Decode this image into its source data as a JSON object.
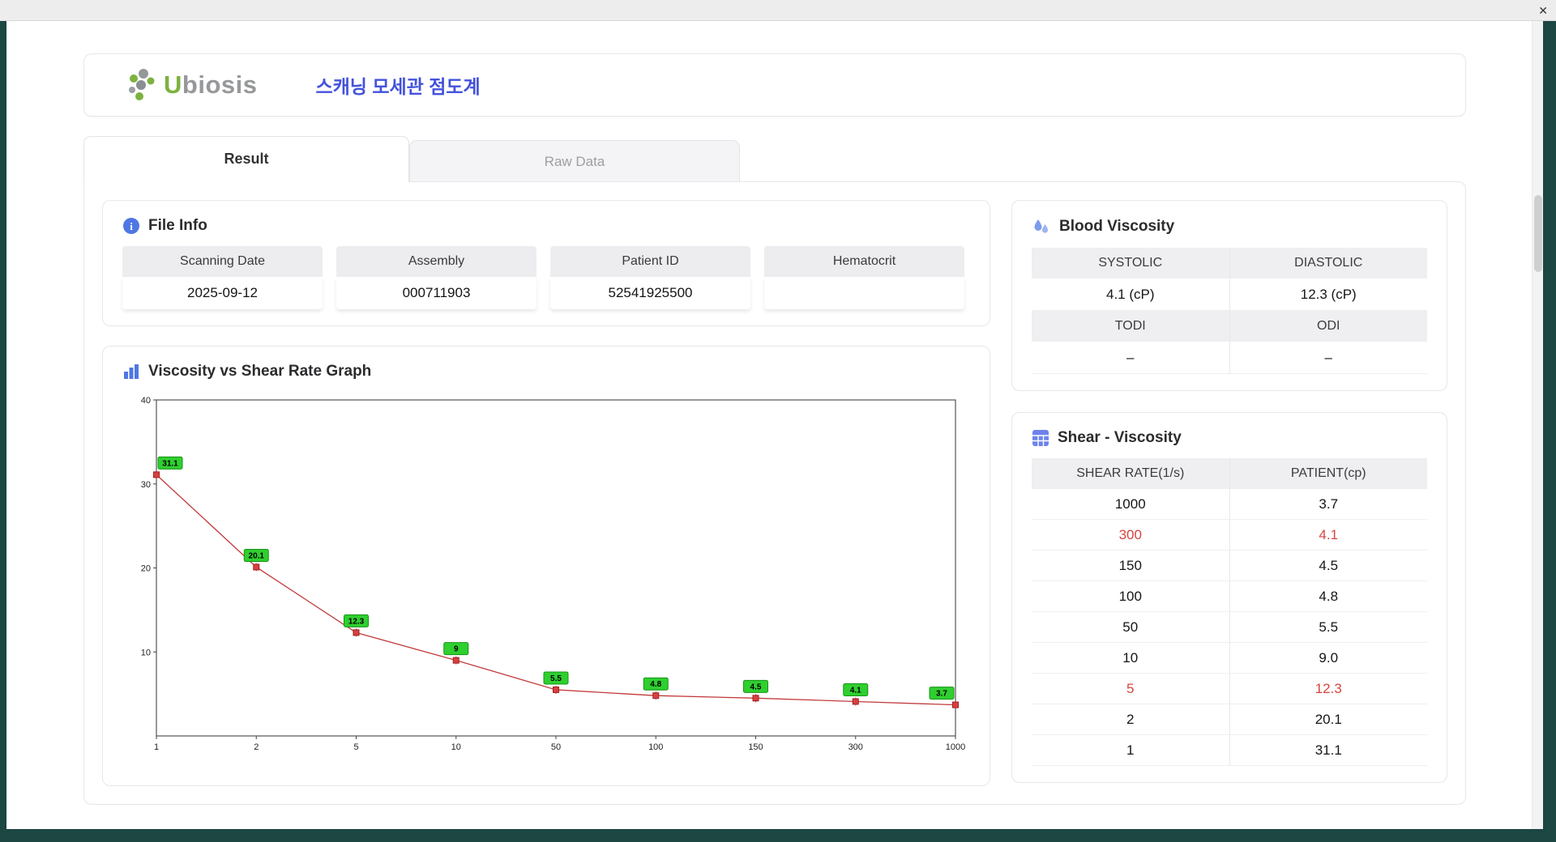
{
  "window": {
    "close_label": "✕"
  },
  "header": {
    "brand_u": "U",
    "brand_rest": "biosis",
    "title": "스캐닝 모세관 점도계"
  },
  "tabs": [
    {
      "label": "Result",
      "active": true
    },
    {
      "label": "Raw Data",
      "active": false
    }
  ],
  "file_info": {
    "title": "File Info",
    "icon": "info-circle-icon",
    "fields": [
      {
        "label": "Scanning Date",
        "value": "2025-09-12"
      },
      {
        "label": "Assembly",
        "value": "000711903"
      },
      {
        "label": "Patient ID",
        "value": "52541925500"
      },
      {
        "label": "Hematocrit",
        "value": ""
      }
    ]
  },
  "graph": {
    "title": "Viscosity vs Shear Rate Graph",
    "icon": "bar-chart-icon"
  },
  "blood_viscosity": {
    "title": "Blood Viscosity",
    "icon": "water-drops-icon",
    "sections": [
      {
        "headers": [
          "SYSTOLIC",
          "DIASTOLIC"
        ],
        "values": [
          "4.1 (cP)",
          "12.3 (cP)"
        ]
      },
      {
        "headers": [
          "TODI",
          "ODI"
        ],
        "values": [
          "–",
          "–"
        ]
      }
    ]
  },
  "shear_table": {
    "title": "Shear - Viscosity",
    "icon": "grid-table-icon",
    "columns": [
      "SHEAR RATE(1/s)",
      "PATIENT(cp)"
    ],
    "rows": [
      {
        "shear": "1000",
        "patient": "3.7",
        "highlight": false
      },
      {
        "shear": "300",
        "patient": "4.1",
        "highlight": true
      },
      {
        "shear": "150",
        "patient": "4.5",
        "highlight": false
      },
      {
        "shear": "100",
        "patient": "4.8",
        "highlight": false
      },
      {
        "shear": "50",
        "patient": "5.5",
        "highlight": false
      },
      {
        "shear": "10",
        "patient": "9.0",
        "highlight": false
      },
      {
        "shear": "5",
        "patient": "12.3",
        "highlight": true
      },
      {
        "shear": "2",
        "patient": "20.1",
        "highlight": false
      },
      {
        "shear": "1",
        "patient": "31.1",
        "highlight": false
      }
    ]
  },
  "chart_data": {
    "type": "line",
    "title": "Viscosity vs Shear Rate Graph",
    "x": [
      1,
      2,
      5,
      10,
      50,
      100,
      150,
      300,
      1000
    ],
    "y": [
      31.1,
      20.1,
      12.3,
      9,
      5.5,
      4.8,
      4.5,
      4.1,
      3.7
    ],
    "point_labels": [
      "31.1",
      "20.1",
      "12.3",
      "9",
      "5.5",
      "4.8",
      "4.5",
      "4.1",
      "3.7"
    ],
    "x_ticks": [
      "1",
      "2",
      "5",
      "10",
      "50",
      "100",
      "150",
      "300",
      "1000"
    ],
    "y_ticks": [
      10,
      20,
      30,
      40
    ],
    "ylim": [
      0,
      40
    ],
    "x_scale": "log-categorical",
    "grid": "dashed",
    "xlabel": "",
    "ylabel": "",
    "line_color": "#c23b3b",
    "marker_color": "#d84040",
    "marker_border": "#a02020",
    "label_bg": "#2fcf2f",
    "label_border": "#169416"
  },
  "colors": {
    "accent_blue": "#4352dc",
    "highlight_red": "#d64541",
    "icon_blue": "#4f77e3",
    "logo_green": "#7cb23f"
  }
}
